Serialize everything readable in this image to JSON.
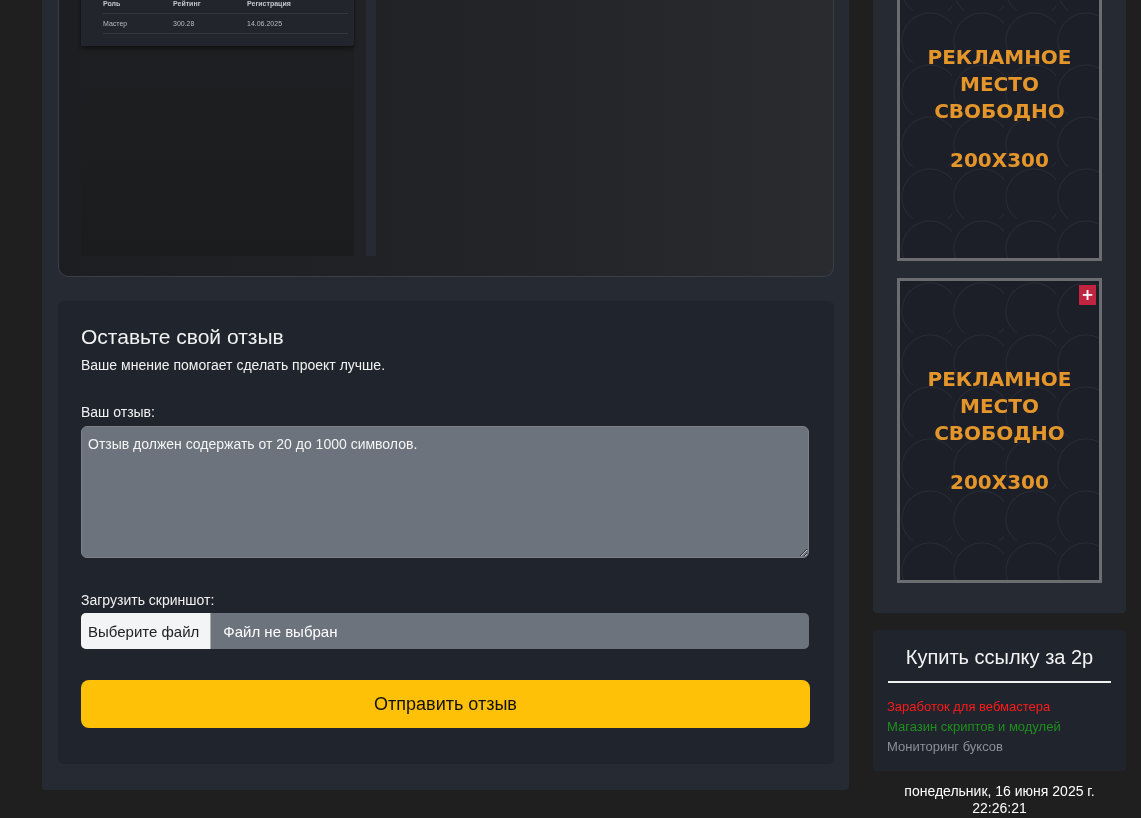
{
  "preview": {
    "table": {
      "columns": [
        "Роль",
        "Рейтинг",
        "Регистрация"
      ],
      "rows": [
        [
          "Мастер",
          "300.28",
          "14.06.2025"
        ]
      ]
    }
  },
  "review_form": {
    "title": "Оставьте свой отзыв",
    "subtitle": "Ваше мнение помогает сделать проект лучше.",
    "review_label": "Ваш отзыв:",
    "placeholder": "Отзыв должен содержать от 20 до 1000 символов.",
    "screenshot_label": "Загрузить скриншот:",
    "file_button": "Выберите файл",
    "file_status": "Файл не выбран",
    "submit": "Отправить отзыв"
  },
  "ads": [
    {
      "lines": [
        "РЕКЛАМНОЕ",
        "МЕСТО",
        "СВОБОДНО"
      ],
      "size": "200X300"
    },
    {
      "lines": [
        "РЕКЛАМНОЕ",
        "МЕСТО",
        "СВОБОДНО"
      ],
      "size": "200X300",
      "badge": "+"
    }
  ],
  "links_card": {
    "title": "Купить ссылку за 2р",
    "links": [
      {
        "label": "Заработок для вебмастера",
        "color": "#ff1a1a"
      },
      {
        "label": "Магазин скриптов и модулей",
        "color": "#1f8f1f"
      },
      {
        "label": "Мониторинг буксов",
        "color": "#8a8f98"
      }
    ]
  },
  "footer": {
    "date": "понедельник, 16 июня 2025 г.",
    "time": "22:26:21"
  }
}
